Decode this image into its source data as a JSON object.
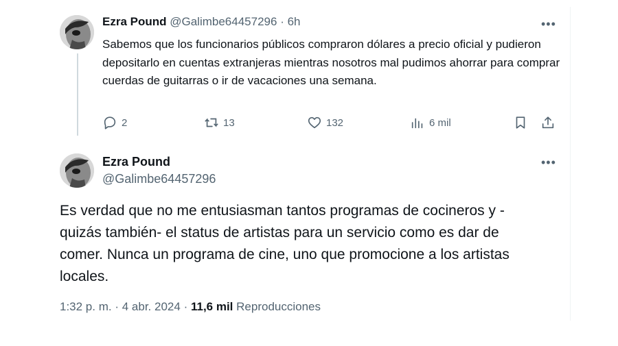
{
  "post1": {
    "author_name": "Ezra Pound",
    "handle": "@Galimbe64457296",
    "separator": "·",
    "time": "6h",
    "more_label": "•••",
    "text": "Sabemos que los funcionarios públicos compraron dólares a precio oficial y pudieron depositarlo en cuentas extranjeras mientras nosotros mal pudimos ahorrar para comprar cuerdas de guitarras o ir de vacaciones una semana.",
    "actions": {
      "replies": "2",
      "reposts": "13",
      "likes": "132",
      "views": "6 mil"
    },
    "icons": [
      "reply-icon",
      "repost-icon",
      "like-icon",
      "views-icon",
      "bookmark-icon",
      "share-icon"
    ]
  },
  "post2": {
    "author_name": "Ezra Pound",
    "handle": "@Galimbe64457296",
    "more_label": "•••",
    "text": "Es verdad que no me entusiasman tantos programas de cocineros y -quizás también- el status de artistas para un servicio como es dar de comer. Nunca un programa de cine, uno que promocione a los artistas locales.",
    "time": "1:32 p. m.",
    "date": "4 abr. 2024",
    "separator": "·",
    "views_count": "11,6 mil",
    "views_label": "Reproducciones"
  },
  "colors": {
    "text": "#0f1419",
    "secondary": "#536471",
    "thread_line": "#cfd9de"
  }
}
